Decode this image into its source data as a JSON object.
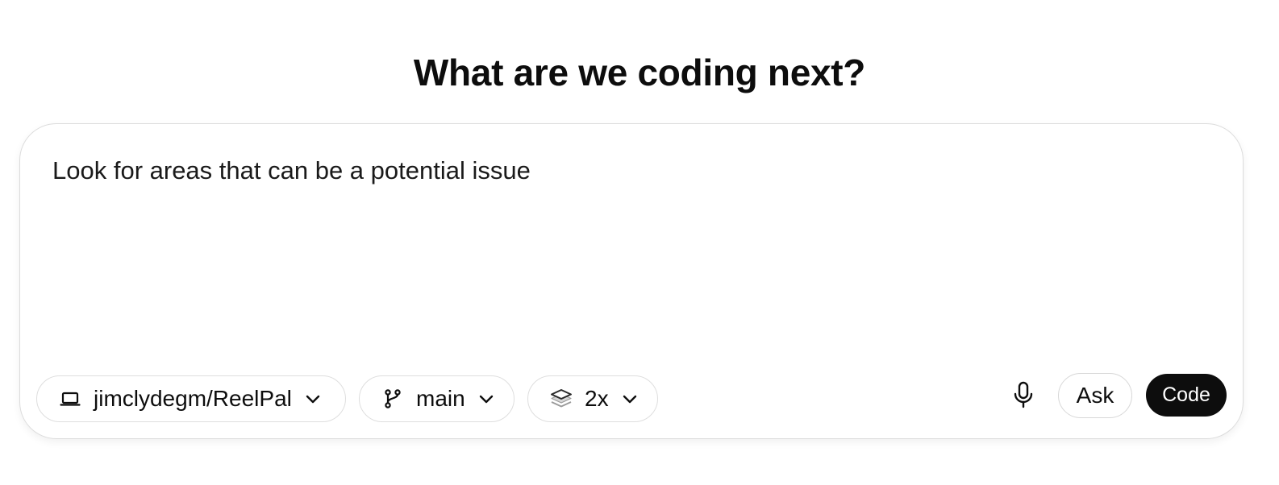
{
  "heading": "What are we coding next?",
  "prompt": {
    "text": "Look for areas that can be a potential issue"
  },
  "toolbar": {
    "repo": {
      "label": "jimclydegm/ReelPal",
      "icon": "laptop-icon"
    },
    "branch": {
      "label": "main",
      "icon": "git-branch-icon"
    },
    "versions": {
      "label": "2x",
      "icon": "layers-icon"
    },
    "mic_icon": "microphone-icon",
    "ask_label": "Ask",
    "code_label": "Code"
  },
  "colors": {
    "primary_button_bg": "#0d0d0d",
    "primary_button_text": "#ffffff",
    "border": "#dcdcdc",
    "text": "#0d0d0d"
  }
}
